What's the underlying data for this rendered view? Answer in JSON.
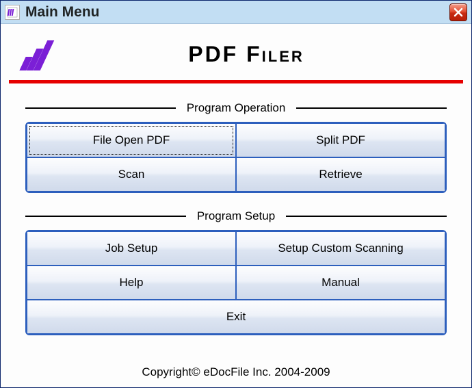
{
  "window": {
    "title": "Main Menu"
  },
  "header": {
    "app_title": "PDF Filer"
  },
  "sections": {
    "operation": {
      "label": "Program Operation",
      "buttons": {
        "file_open": "File Open PDF",
        "split": "Split PDF",
        "scan": "Scan",
        "retrieve": "Retrieve"
      }
    },
    "setup": {
      "label": "Program Setup",
      "buttons": {
        "job_setup": "Job Setup",
        "custom_scan": "Setup Custom Scanning",
        "help": "Help",
        "manual": "Manual",
        "exit": "Exit"
      }
    }
  },
  "footer": {
    "copyright": "Copyright© eDocFile Inc. 2004-2009"
  }
}
